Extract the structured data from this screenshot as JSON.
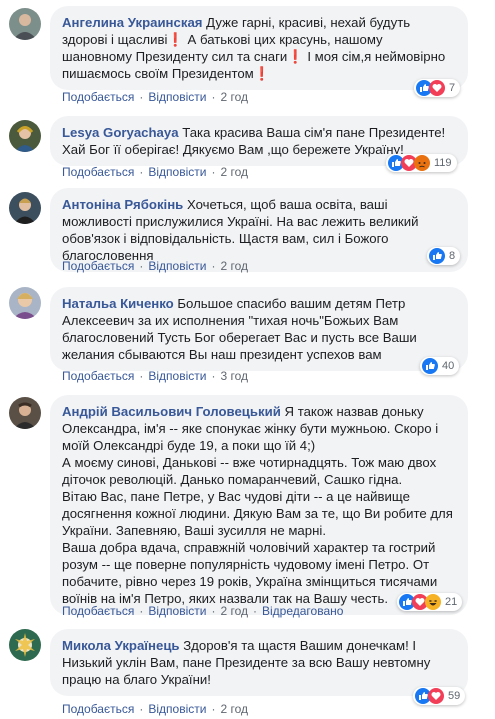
{
  "ui": {
    "like": "Подобається",
    "reply": "Відповісти",
    "edited": "Відредаговано"
  },
  "comments": [
    {
      "author": "Ангелина Украинская",
      "text": "Дуже гарні, красиві, нехай будуть здорові і щасливі❗ А батькові цих красунь, нашому шановному Президенту сил та снаги❗ І моя сім,я неймовірно пишаємось своїм Президентом❗",
      "time": "2 год",
      "reaction_count": "7"
    },
    {
      "author": "Lesya Goryachaya",
      "text": "Така красива Ваша сім'я пане Президенте! Хай Бог її оберігає! Дякуємо Вам ,що бережете Україну!",
      "time": "2 год",
      "reaction_count": "119"
    },
    {
      "author": "Антоніна Рябокінь",
      "text": "Хочеться, щоб ваша освіта, ваші можливості прислужилися Україні. На вас лежить великий обов'язок і відповідальність. Щастя вам, сил і Божого благословення",
      "time": "2 год",
      "reaction_count": "8"
    },
    {
      "author": "Натальа Киченко",
      "text": "Большое спасибо вашим детям Петр Алексеевич за их исполнения \"тихая ночь\"Божьих Вам благословений Тусть Бог оберегает Вас и пусть все Ваши желания сбываются Вы наш президент успехов вам",
      "time": "3 год",
      "reaction_count": "40"
    },
    {
      "author": "Андрій Васильович Головецький",
      "text": "Я також назвав доньку Олександра, ім'я -- яке спонукає жінку бути мужньою. Скоро і моїй Олександрі буде 19, а поки що їй 4;)\nА моєму синові, Данькові -- вже чотирнадцять. Тож маю двох діточок революцій. Данько помаранчевий, Сашко гідна.\nВітаю Вас, пане Петре, у Вас чудові діти -- а це найвище досягнення кожної людини. Дякую Вам за те, що Ви робите для України. Запевняю, Ваші зусилля не марні.\nВаша добра вдача, справжній чоловічий характер та гострий розум -- ще поверне популярність чудовому імені Петро. От побачите, рівно через 19 років, Україна змінщиться тисячами воїнів на ім'я Петро, яких назвали так на Вашу честь.",
      "time": "2 год",
      "edited": true,
      "reaction_count": "21"
    },
    {
      "author": "Микола Українець",
      "text": "Здоров'я та щастя Вашим донечкам! І Низький уклін Вам, пане Президенте за всю Вашу невтомну працю на благо України!",
      "time": "2 год",
      "reaction_count": "59"
    }
  ],
  "colors": {
    "link": "#385898",
    "bubble": "#f2f3f5",
    "meta": "#606770",
    "like": "#1877f2",
    "love": "#f33e58",
    "angry": "#e9710f",
    "haha": "#f7b125"
  }
}
